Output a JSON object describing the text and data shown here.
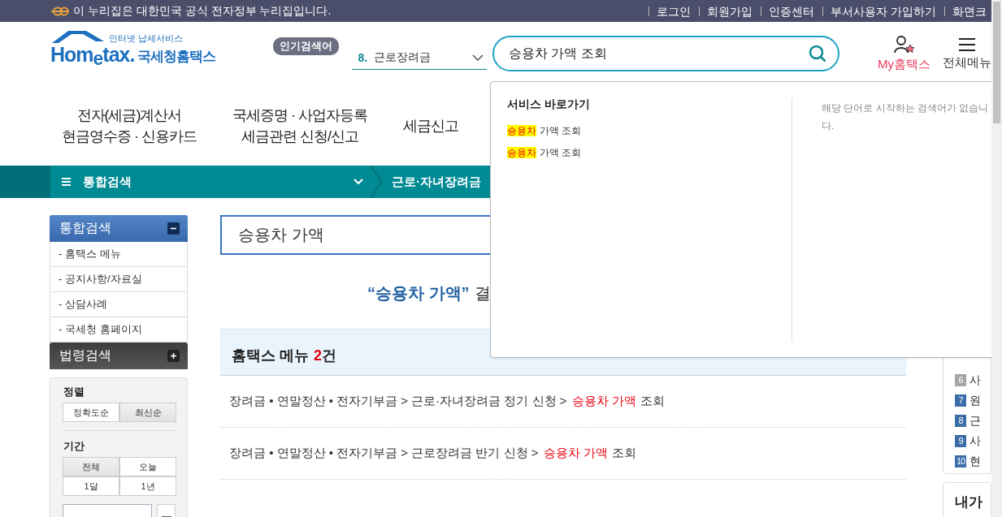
{
  "top_bar": {
    "notice": "이 누리집은 대한민국 공식 전자정부 누리집입니다.",
    "links": [
      "로그인",
      "회원가입",
      "인증센터",
      "부서사용자 가입하기",
      "화면크"
    ]
  },
  "header": {
    "logo": {
      "tagline": "인터넷 납세서비스",
      "wordmark": "Hom$_{e}$tax.",
      "name": "국세청홈택스"
    },
    "popular": {
      "label": "인기검색어",
      "rank": "8.",
      "term": "근로장려금"
    },
    "search": {
      "value": "승용차 가액 조회"
    },
    "my_menu": "My홈택스",
    "all_menu": "전체메뉴"
  },
  "nav": [
    {
      "lines": [
        "전자(세금)계산서",
        "현금영수증 · 신용카드"
      ]
    },
    {
      "lines": [
        "국세증명 · 사업자등록",
        "세금관련 신청/신고"
      ]
    },
    {
      "lines": [
        "세금신고"
      ]
    }
  ],
  "location_bar": {
    "home_menu": "통합검색",
    "current": "근로·자녀장려금"
  },
  "sidebar": {
    "groups": [
      {
        "title": "통합검색",
        "expanded": true,
        "items": [
          "- 홈택스 메뉴",
          "- 공지사항/자료실",
          "- 상담사례",
          "- 국세청 홈페이지"
        ]
      },
      {
        "title": "법령검색",
        "expanded": false
      }
    ],
    "sort": {
      "label": "정렬",
      "options": [
        {
          "label": "정확도순",
          "selected": false
        },
        {
          "label": "최신순",
          "selected": true
        }
      ]
    },
    "period": {
      "label": "기간",
      "options": [
        {
          "label": "전체",
          "selected": true
        },
        {
          "label": "오늘",
          "selected": false
        },
        {
          "label": "1달",
          "selected": false
        },
        {
          "label": "1년",
          "selected": false
        }
      ]
    }
  },
  "results": {
    "query": "승용차 가액",
    "summary_query": "“승용차 가액”",
    "summary_rest": "결",
    "section": {
      "title": "홈택스 메뉴",
      "count": "2",
      "unit": "건"
    },
    "rows": [
      {
        "path": "장려금 • 연말정산 • 전자기부금 > 근로·자녀장려금 정기 신청 >",
        "highlight": "승용차 가액",
        "rest": "조회"
      },
      {
        "path": "장려금 • 연말정산 • 전자기부금 > 근로장려금 반기 신청 >",
        "highlight": "승용차 가액",
        "rest": "조회"
      }
    ]
  },
  "ranking": {
    "items": [
      {
        "rank": "6",
        "text": "사",
        "color": "#a5a5a5"
      },
      {
        "rank": "7",
        "text": "원",
        "color": "#3b6ea8"
      },
      {
        "rank": "8",
        "text": "근",
        "color": "#3b6ea8"
      },
      {
        "rank": "9",
        "text": "사",
        "color": "#3b6ea8"
      },
      {
        "rank": "10",
        "text": "현",
        "color": "#3b6ea8"
      }
    ]
  },
  "my_box": {
    "title": "내가"
  },
  "suggestions": {
    "title": "서비스 바로가기",
    "items": [
      {
        "match": "승용차",
        "rest": "가액 조회"
      },
      {
        "match": "승용차",
        "rest": "가액 조회"
      }
    ],
    "message": "해당 단어로 시작하는 검색어가 없습니다."
  }
}
